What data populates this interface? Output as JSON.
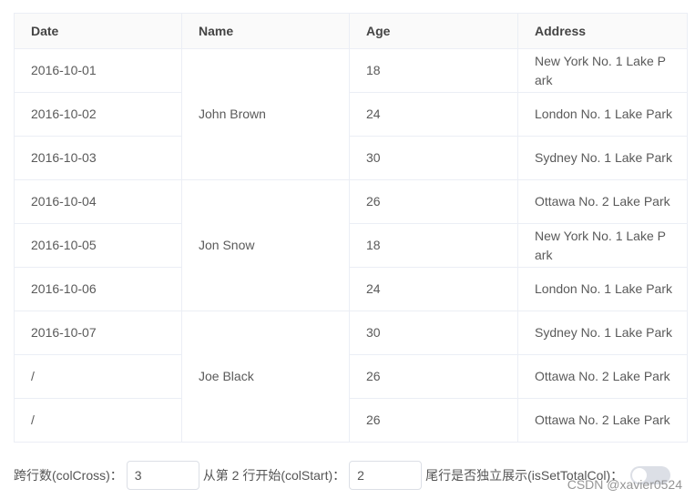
{
  "table": {
    "headers": [
      "Date",
      "Name",
      "Age",
      "Address"
    ],
    "rows": [
      {
        "date": "2016-10-01",
        "age": "18",
        "address": "New York No. 1 Lake Park"
      },
      {
        "date": "2016-10-02",
        "age": "24",
        "address": "London No. 1 Lake Park"
      },
      {
        "date": "2016-10-03",
        "age": "30",
        "address": "Sydney No. 1 Lake Park"
      },
      {
        "date": "2016-10-04",
        "age": "26",
        "address": "Ottawa No. 2 Lake Park"
      },
      {
        "date": "2016-10-05",
        "age": "18",
        "address": "New York No. 1 Lake Park"
      },
      {
        "date": "2016-10-06",
        "age": "24",
        "address": "London No. 1 Lake Park"
      },
      {
        "date": "2016-10-07",
        "age": "30",
        "address": "Sydney No. 1 Lake Park"
      },
      {
        "date": "/",
        "age": "26",
        "address": "Ottawa No. 2 Lake Park"
      },
      {
        "date": "/",
        "age": "26",
        "address": "Ottawa No. 2 Lake Park"
      }
    ],
    "names": [
      "John Brown",
      "Jon Snow",
      "Joe Black"
    ]
  },
  "controls": {
    "col_cross_label": "跨行数(colCross)：",
    "col_cross_value": "3",
    "col_start_label": "从第 2 行开始(colStart)：",
    "col_start_value": "2",
    "total_col_label": "尾行是否独立展示(isSetTotalCol)：",
    "total_col_on": false
  },
  "watermark": "CSDN @xavier0524"
}
